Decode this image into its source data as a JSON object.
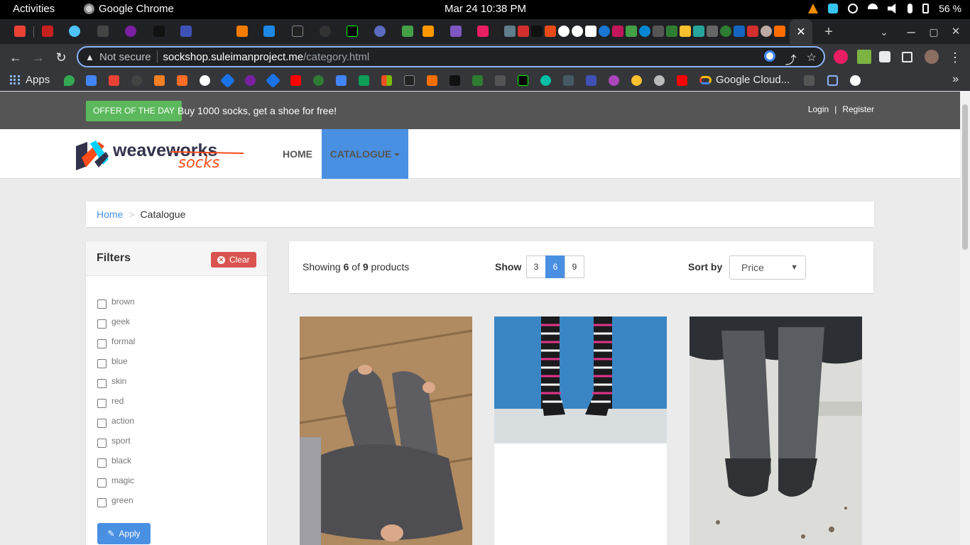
{
  "system_bar": {
    "activities": "Activities",
    "app_name": "Google Chrome",
    "clock": "Mar 24  10:38 PM",
    "battery": "56 %"
  },
  "browser": {
    "omnibox": {
      "security_label": "Not secure",
      "host": "sockshop.suleimanproject.me",
      "path": "/category.html"
    },
    "bookmarks": {
      "apps_label": "Apps",
      "google_cloud_label": "Google Cloud..."
    }
  },
  "site": {
    "offer_badge": "OFFER OF THE DAY",
    "offer_text": "Buy 1000 socks, get a shoe for free!",
    "login": "Login",
    "auth_separator": "|",
    "register": "Register",
    "logo_weave": "weaveworks",
    "logo_socks": "socks",
    "nav": {
      "home": "HOME",
      "catalogue": "CATALOGUE"
    },
    "breadcrumb": {
      "home": "Home",
      "separator": ">",
      "current": "Catalogue"
    },
    "filters": {
      "title": "Filters",
      "clear": "Clear",
      "tags": [
        "brown",
        "geek",
        "formal",
        "blue",
        "skin",
        "red",
        "action",
        "sport",
        "black",
        "magic",
        "green"
      ],
      "apply": "Apply"
    },
    "products_head": {
      "showing_prefix": "Showing ",
      "shown": "6",
      "of_text": " of ",
      "total": "9",
      "suffix": " products",
      "show_label": "Show",
      "page_sizes": [
        "3",
        "6",
        "9"
      ],
      "active_page_size": "6",
      "sort_label": "Sort by",
      "sort_value": "Price"
    }
  },
  "colors": {
    "accent": "#4a90e2",
    "offer_green": "#5cb85c",
    "clear_red": "#d9534f",
    "topbar": "#555555"
  }
}
